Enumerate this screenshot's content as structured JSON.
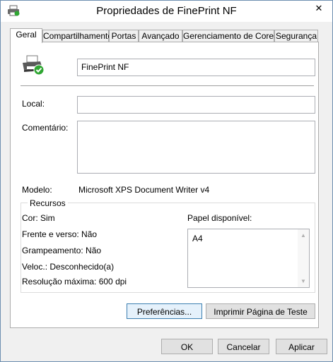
{
  "window": {
    "title": "Propriedades de FinePrint NF",
    "close_glyph": "✕"
  },
  "tabs": [
    {
      "label": "Geral",
      "active": true
    },
    {
      "label": "Compartilhamento",
      "active": false
    },
    {
      "label": "Portas",
      "active": false
    },
    {
      "label": "Avançado",
      "active": false
    },
    {
      "label": "Gerenciamento de Cores",
      "active": false
    },
    {
      "label": "Segurança",
      "active": false
    }
  ],
  "general": {
    "printer_name": "FinePrint NF",
    "location_label": "Local:",
    "location_value": "",
    "comment_label": "Comentário:",
    "comment_value": "",
    "model_label": "Modelo:",
    "model_value": "Microsoft XPS Document Writer v4"
  },
  "features": {
    "group_title": "Recursos",
    "color": "Cor: Sim",
    "duplex": "Frente e verso: Não",
    "staple": "Grampeamento: Não",
    "speed": "Veloc.: Desconhecido(a)",
    "max_resolution": "Resolução máxima: 600 dpi",
    "paper_label": "Papel disponível:",
    "paper_items": [
      "A4"
    ]
  },
  "buttons": {
    "preferences": "Preferências...",
    "print_test": "Imprimir Página de Teste",
    "ok": "OK",
    "cancel": "Cancelar",
    "apply": "Aplicar"
  },
  "icons": {
    "title": "printer-icon",
    "printer": "printer-check-icon",
    "close": "close-icon"
  }
}
